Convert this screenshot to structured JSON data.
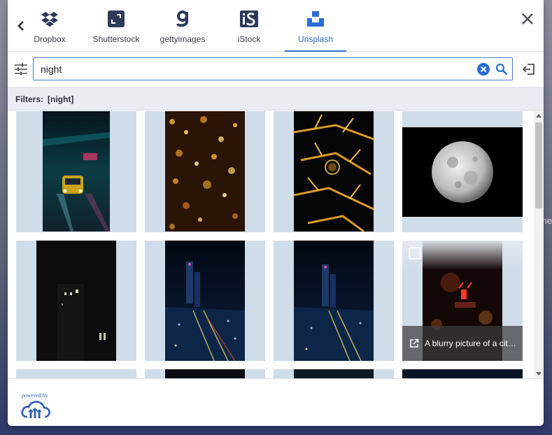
{
  "backdrop": {
    "edge_text": "ne"
  },
  "tabs": [
    {
      "label": "Dropbox",
      "icon": "dropbox-icon"
    },
    {
      "label": "Shutterstock",
      "icon": "shutterstock-icon"
    },
    {
      "label": "gettyimages",
      "icon": "gettyimages-icon"
    },
    {
      "label": "iStock",
      "icon": "istock-icon"
    },
    {
      "label": "Unsplash",
      "icon": "unsplash-icon",
      "active": true
    }
  ],
  "search": {
    "value": "night"
  },
  "filters": {
    "label": "Filters:",
    "value": "[night]"
  },
  "gallery": {
    "hover_caption": "A blurry picture of a cit…"
  },
  "footer": {
    "powered_by": "powered by"
  },
  "colors": {
    "accent": "#2b6cd4",
    "card_bg": "#cfdce9"
  }
}
